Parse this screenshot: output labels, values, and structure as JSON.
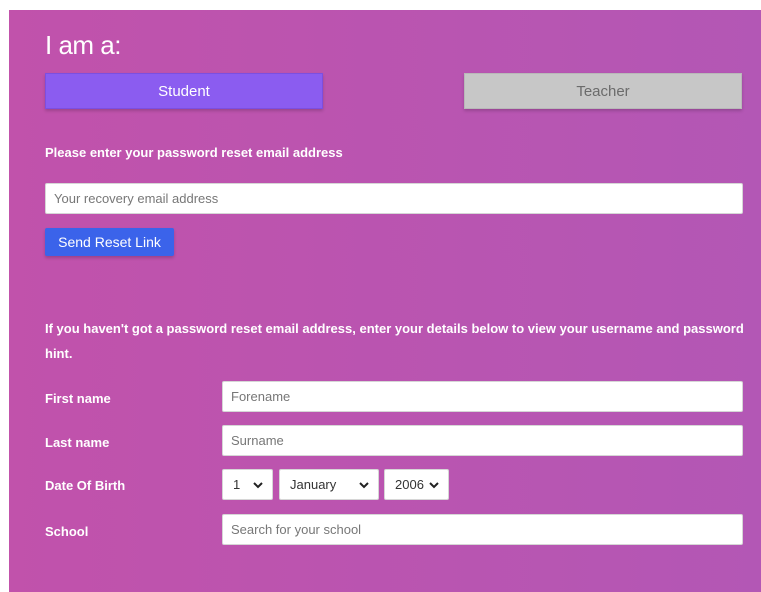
{
  "heading": "I am a:",
  "roles": {
    "student": "Student",
    "teacher": "Teacher"
  },
  "reset": {
    "prompt": "Please enter your password reset email address",
    "email_placeholder": "Your recovery email address",
    "send_label": "Send Reset Link"
  },
  "hint_text": "If you haven't got a password reset email address, enter your details below to view your username and password hint.",
  "form": {
    "first_name_label": "First name",
    "first_name_placeholder": "Forename",
    "last_name_label": "Last name",
    "last_name_placeholder": "Surname",
    "dob_label": "Date Of Birth",
    "dob_day": "1",
    "dob_month": "January",
    "dob_year": "2006",
    "school_label": "School",
    "school_placeholder": "Search for your school"
  },
  "colors": {
    "background": "#bb55b0",
    "student_active": "#8b5cf0",
    "teacher_inactive": "#c7c7c7",
    "send_button": "#3b63ea"
  }
}
